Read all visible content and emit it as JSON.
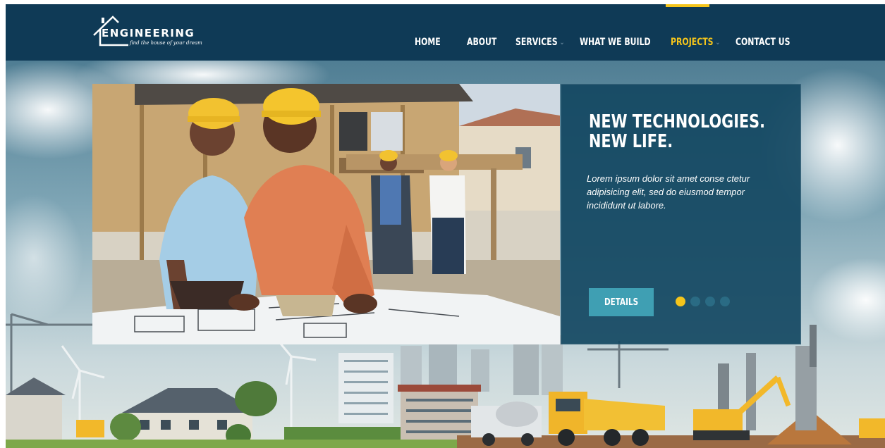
{
  "header": {
    "logo": {
      "name": "ENGINEERING",
      "tagline": "find the house of your dream"
    },
    "nav": [
      {
        "label": "HOME",
        "has_dropdown": false,
        "active": false
      },
      {
        "label": "ABOUT",
        "has_dropdown": false,
        "active": false
      },
      {
        "label": "SERVICES",
        "has_dropdown": true,
        "active": false
      },
      {
        "label": "WHAT WE BUILD",
        "has_dropdown": false,
        "active": false
      },
      {
        "label": "PROJECTS",
        "has_dropdown": true,
        "active": true
      },
      {
        "label": "CONTACT US",
        "has_dropdown": false,
        "active": false
      }
    ]
  },
  "slider": {
    "heading_line1": "NEW TECHNOLOGIES.",
    "heading_line2": "NEW LIFE.",
    "text": "Lorem ipsum dolor sit amet conse ctetur adipisicing elit, sed do eiusmod tempor incididunt ut labore.",
    "button_label": "DETAILS",
    "slide_count": 4,
    "active_slide": 1
  },
  "icons": {
    "logo": "house-outline-icon",
    "nav_caret": "chevron-down-icon"
  },
  "colors": {
    "header_bg": "#0f3a56",
    "accent": "#f5c51b",
    "caption_bg": "#144862",
    "button_bg": "#3f9fb3"
  }
}
